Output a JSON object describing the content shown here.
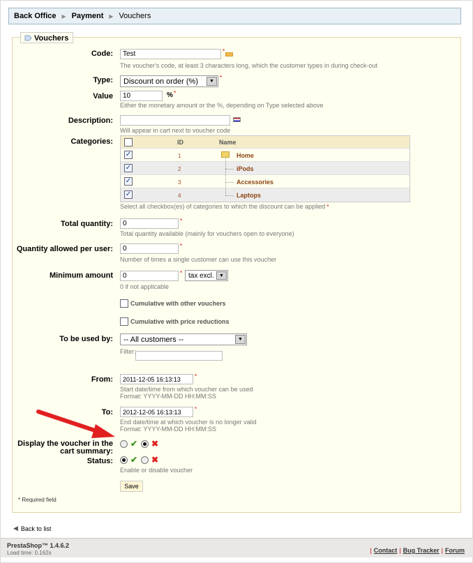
{
  "breadcrumb": {
    "items": [
      "Back Office",
      "Payment",
      "Vouchers"
    ]
  },
  "legend": {
    "label": "Vouchers"
  },
  "code": {
    "label": "Code:",
    "value": "Test",
    "hint": "The voucher's code, at least 3 characters long, which the customer types in during check-out"
  },
  "type": {
    "label": "Type:",
    "selected": "Discount on order (%)"
  },
  "value": {
    "label": "Value",
    "value": "10",
    "unit": "%",
    "hint": "Either the monetary amount or the %, depending on Type selected above"
  },
  "description": {
    "label": "Description:",
    "value": "",
    "hint": "Will appear in cart next to voucher code"
  },
  "categories": {
    "label": "Categories:",
    "col_id": "ID",
    "col_name": "Name",
    "rows": [
      {
        "id": "1",
        "name": "Home",
        "checked": true
      },
      {
        "id": "2",
        "name": "iPods",
        "checked": true
      },
      {
        "id": "3",
        "name": "Accessories",
        "checked": true
      },
      {
        "id": "4",
        "name": "Laptops",
        "checked": true
      }
    ],
    "hint": "Select all checkbox(es) of categories to which the discount can be applied"
  },
  "total_qty": {
    "label": "Total quantity:",
    "value": "0",
    "hint": "Total quantity available (mainly for vouchers open to everyone)"
  },
  "qty_per_user": {
    "label": "Quantity allowed per user:",
    "value": "0",
    "hint": "Number of times a single customer can use this voucher"
  },
  "min_amount": {
    "label": "Minimum amount",
    "value": "0",
    "tax_selected": "tax excl.",
    "hint": "0 if not applicable"
  },
  "cumulative_vouchers": {
    "label": "Cumulative with other vouchers",
    "checked": false
  },
  "cumulative_reductions": {
    "label": "Cumulative with price reductions",
    "checked": false
  },
  "used_by": {
    "label": "To be used by:",
    "selected": "-- All customers --",
    "filter_label": "Filter:",
    "filter_value": ""
  },
  "from": {
    "label": "From:",
    "value": "2011-12-05 16:13:13",
    "hint1": "Start date/time from which voucher can be used",
    "hint2": "Format: YYYY-MM-DD HH:MM:SS"
  },
  "to": {
    "label": "To:",
    "value": "2012-12-05 16:13:13",
    "hint1": "End date/time at which voucher is no longer valid",
    "hint2": "Format: YYYY-MM-DD HH:MM:SS"
  },
  "display_cart": {
    "label_line1": "Display the voucher in the",
    "label_line2": "cart summary:",
    "selected": "no"
  },
  "status": {
    "label": "Status:",
    "selected": "yes",
    "hint": "Enable or disable voucher"
  },
  "save_label": "Save",
  "required_note": "* Required field",
  "back_link": "Back to list",
  "footer": {
    "version": "PrestaShop™ 1.4.6.2",
    "load_time": "Load time: 0.162s",
    "links": [
      "Contact",
      "Bug Tracker",
      "Forum"
    ]
  },
  "colors": {
    "accent": "#8b4513",
    "required": "#cc0000",
    "check": "#3a9a1f",
    "cross": "#dd2222",
    "arrow": "#e02020"
  }
}
